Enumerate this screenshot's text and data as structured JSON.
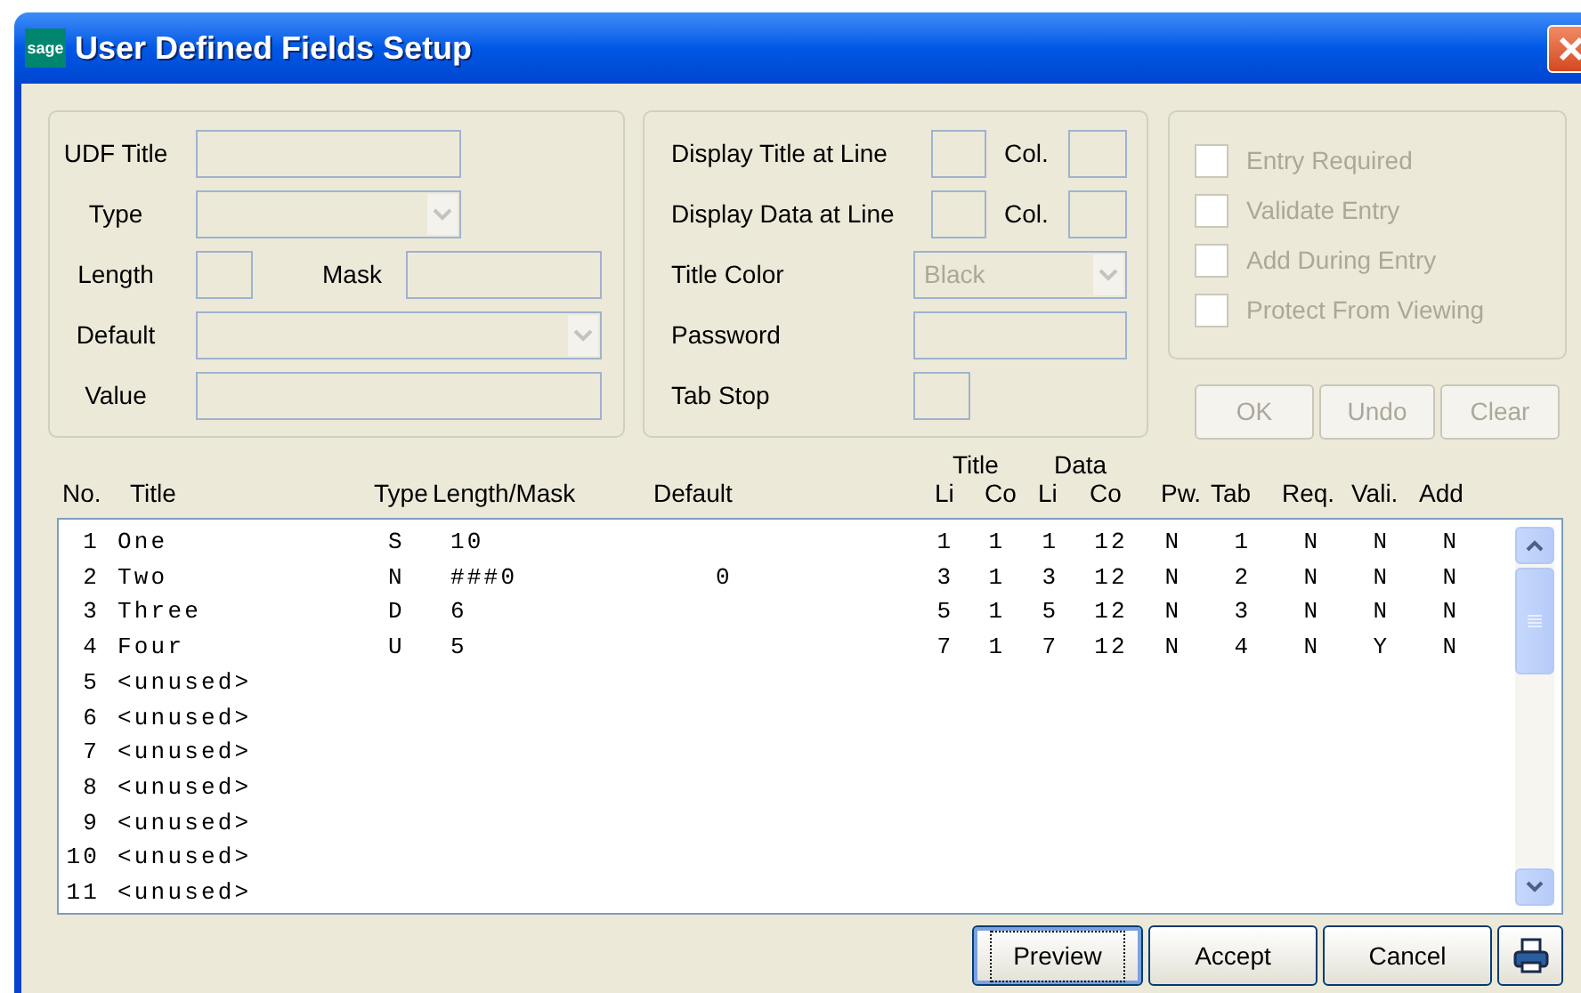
{
  "window": {
    "title": "User Defined Fields Setup",
    "logo": "sage"
  },
  "udf_title": {
    "label": "UDF Title"
  },
  "type": {
    "label": "Type"
  },
  "length": {
    "label": "Length"
  },
  "mask": {
    "label": "Mask"
  },
  "default": {
    "label": "Default"
  },
  "value": {
    "label": "Value"
  },
  "display_title": {
    "label": "Display Title at Line",
    "col_label": "Col."
  },
  "display_data": {
    "label": "Display Data at Line",
    "col_label": "Col."
  },
  "title_color": {
    "label": "Title Color",
    "value": "Black",
    "disabled": true
  },
  "password": {
    "label": "Password"
  },
  "tab_stop": {
    "label": "Tab Stop"
  },
  "options": [
    {
      "label": "Entry Required",
      "checked": false,
      "disabled": true
    },
    {
      "label": "Validate Entry",
      "checked": false,
      "disabled": true
    },
    {
      "label": "Add During Entry",
      "checked": false,
      "disabled": true
    },
    {
      "label": "Protect From Viewing",
      "checked": false,
      "disabled": true
    }
  ],
  "panel_buttons": [
    {
      "label": "OK",
      "disabled": true
    },
    {
      "label": "Undo",
      "disabled": true
    },
    {
      "label": "Clear",
      "disabled": true
    }
  ],
  "column_groups": [
    "Title",
    "Data"
  ],
  "columns": [
    "No.",
    "Title",
    "Type",
    "Length/Mask",
    "Default",
    "Li",
    "Co",
    "Li",
    "Co",
    "Pw.",
    "Tab",
    "Req.",
    "Vali.",
    "Add"
  ],
  "rows": [
    {
      "no": "1",
      "title": "One",
      "type": "S",
      "length_mask": "10",
      "title_li": "1",
      "title_co": "1",
      "data_li": "1",
      "data_co": "12",
      "pw": "N",
      "tab": "1",
      "req": "N",
      "vali": "N",
      "add": "N"
    },
    {
      "no": "2",
      "title": "Two",
      "type": "N",
      "length_mask": "###0",
      "default": "0",
      "title_li": "3",
      "title_co": "1",
      "data_li": "3",
      "data_co": "12",
      "pw": "N",
      "tab": "2",
      "req": "N",
      "vali": "N",
      "add": "N"
    },
    {
      "no": "3",
      "title": "Three",
      "type": "D",
      "length_mask": "6",
      "title_li": "5",
      "title_co": "1",
      "data_li": "5",
      "data_co": "12",
      "pw": "N",
      "tab": "3",
      "req": "N",
      "vali": "N",
      "add": "N"
    },
    {
      "no": "4",
      "title": "Four",
      "type": "U",
      "length_mask": "5",
      "title_li": "7",
      "title_co": "1",
      "data_li": "7",
      "data_co": "12",
      "pw": "N",
      "tab": "4",
      "req": "N",
      "vali": "Y",
      "add": "N"
    },
    {
      "no": "5",
      "title": "<unused>"
    },
    {
      "no": "6",
      "title": "<unused>"
    },
    {
      "no": "7",
      "title": "<unused>"
    },
    {
      "no": "8",
      "title": "<unused>"
    },
    {
      "no": "9",
      "title": "<unused>"
    },
    {
      "no": "10",
      "title": "<unused>"
    },
    {
      "no": "11",
      "title": "<unused>"
    }
  ],
  "buttons": [
    {
      "label": "Preview",
      "default": true
    },
    {
      "label": "Accept",
      "default": false
    },
    {
      "label": "Cancel",
      "default": false
    }
  ]
}
